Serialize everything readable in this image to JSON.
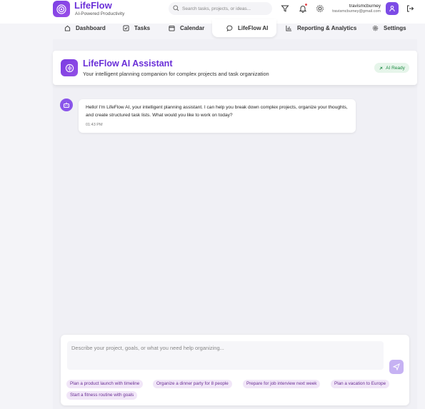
{
  "app": {
    "name": "LifeFlow",
    "tagline": "AI-Powered Productivity"
  },
  "search": {
    "placeholder": "Search tasks, projects, or ideas...",
    "icon": "search-icon"
  },
  "header_icons": [
    "filter-icon",
    "bell-icon",
    "gear-icon",
    "logout-icon"
  ],
  "user": {
    "name": "travismcburney",
    "email": "travismcburney@gmail.com",
    "avatar_icon": "user-icon"
  },
  "nav": {
    "items": [
      {
        "label": "Dashboard",
        "icon": "home-icon"
      },
      {
        "label": "Tasks",
        "icon": "checkbox-icon"
      },
      {
        "label": "Calendar",
        "icon": "calendar-icon"
      },
      {
        "label": "LifeFlow AI",
        "icon": "chat-bubble-icon",
        "active": true
      },
      {
        "label": "Reporting & Analytics",
        "icon": "bar-chart-icon"
      },
      {
        "label": "Settings",
        "icon": "gear-icon"
      }
    ]
  },
  "assistant": {
    "title": "LifeFlow AI Assistant",
    "subtitle": "Your intelligent planning companion for complex projects and task organization",
    "status_badge": "AI Ready"
  },
  "messages": [
    {
      "sender": "bot",
      "text": "Hello! I'm LifeFlow AI, your intelligent planning assistant. I can help you break down complex projects, organize your thoughts, and create structured task lists. What would you like to work on today?",
      "time": "01:43 PM"
    }
  ],
  "composer": {
    "placeholder": "Describe your project, goals, or what you need help organizing...",
    "value": "",
    "send_icon": "send-icon"
  },
  "suggestions": [
    "Plan a product launch with timeline",
    "Organize a dinner party for 8 people",
    "Prepare for job interview next week",
    "Plan a vacation to Europe",
    "Start a fitness routine with goals"
  ],
  "colors": {
    "brand": "#6a2fd8",
    "accent": "#8a55ea",
    "chip_bg": "#f1e6f8",
    "ready": "#1d8a43"
  }
}
